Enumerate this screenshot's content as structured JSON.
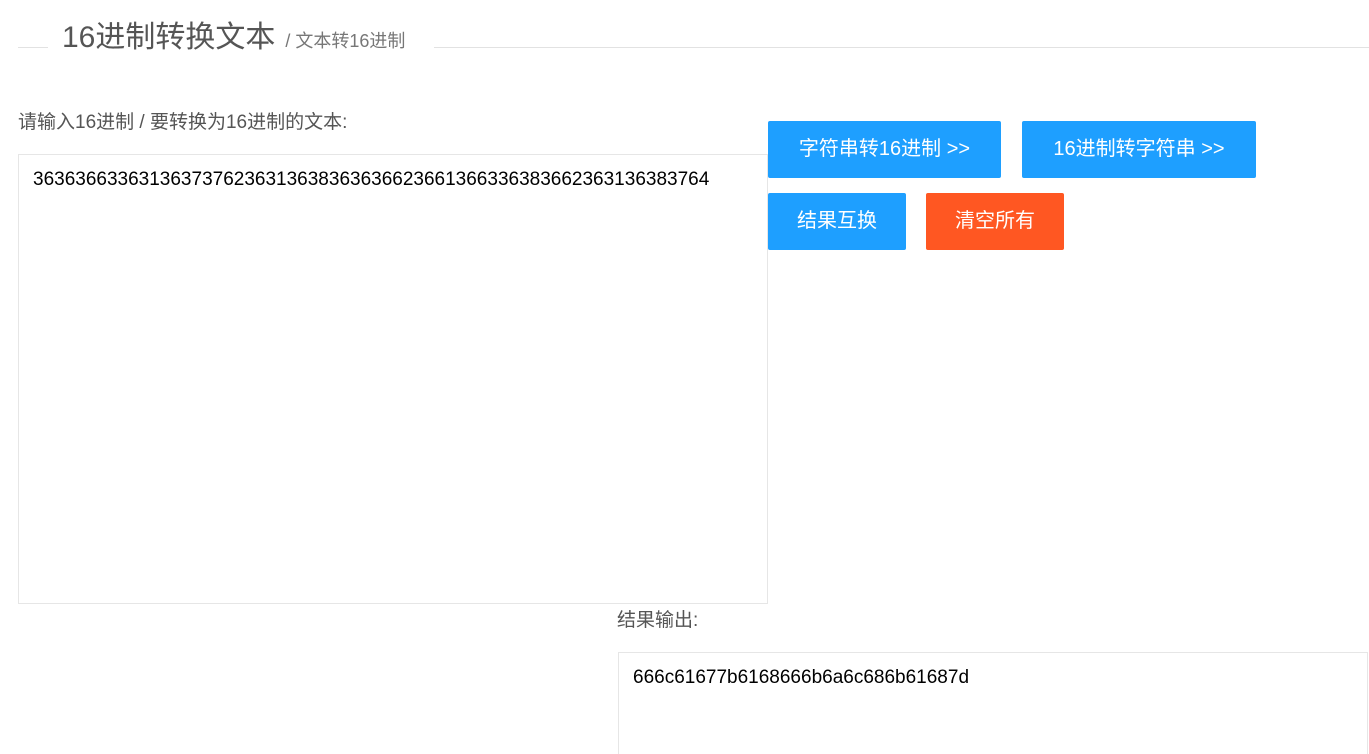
{
  "header": {
    "title": "16进制转换文本",
    "subtitle": "/ 文本转16进制"
  },
  "input": {
    "label": "请输入16进制 / 要转换为16进制的文本:",
    "value": "3636366336313637376236313638363636623661366336383662363136383764"
  },
  "buttons": {
    "string_to_hex": "字符串转16进制 >>",
    "hex_to_string": "16进制转字符串 >>",
    "swap_results": "结果互换",
    "clear_all": "清空所有"
  },
  "output": {
    "label": "结果输出:",
    "value": "666c61677b6168666b6a6c686b61687d"
  },
  "colors": {
    "primary": "#1e9fff",
    "danger": "#ff5722"
  }
}
